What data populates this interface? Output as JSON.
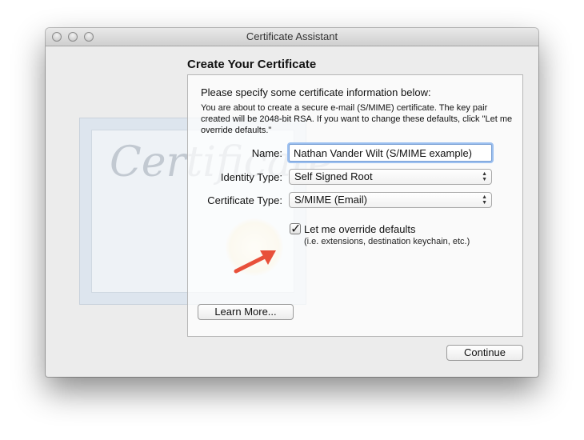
{
  "window": {
    "title": "Certificate Assistant"
  },
  "background": {
    "certificate_word": "Certificate"
  },
  "page": {
    "heading": "Create Your Certificate",
    "intro": "Please specify some certificate information below:",
    "description": "You are about to create a secure e-mail (S/MIME) certificate. The key pair created will be 2048-bit RSA. If you want to change these defaults, click \"Let me override defaults.\""
  },
  "form": {
    "name_label": "Name:",
    "name_value": "Nathan Vander Wilt (S/MIME example)",
    "identity_type_label": "Identity Type:",
    "identity_type_value": "Self Signed Root",
    "certificate_type_label": "Certificate Type:",
    "certificate_type_value": "S/MIME (Email)",
    "override_label": "Let me override defaults",
    "override_sublabel": "(i.e. extensions, destination keychain, etc.)",
    "override_checked": true
  },
  "buttons": {
    "learn_more": "Learn More...",
    "continue": "Continue"
  },
  "colors": {
    "arrow": "#e8503a",
    "focus_ring": "#9cc0f0"
  },
  "icons": {
    "traffic_lights": [
      "close-icon",
      "minimize-icon",
      "zoom-icon"
    ],
    "checkbox": "checkmark-icon",
    "select_indicator": "updown-arrows-icon",
    "annotation": "red-arrow-icon"
  }
}
